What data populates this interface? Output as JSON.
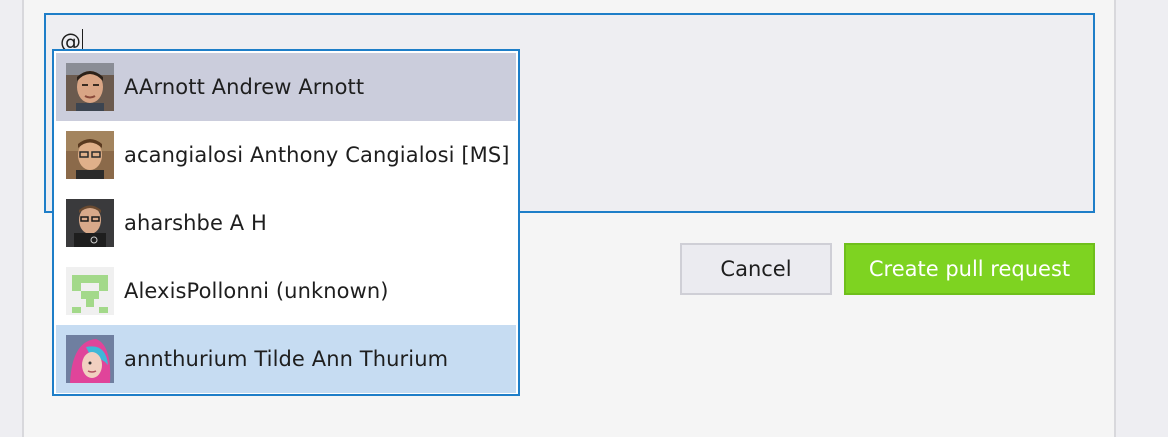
{
  "comment_box": {
    "value": "@"
  },
  "actions": {
    "cancel_label": "Cancel",
    "create_label": "Create pull request"
  },
  "mention_suggestions": {
    "items": [
      {
        "label": "AArnott Andrew Arnott",
        "avatar": "user-avatar-icon",
        "state": "selected"
      },
      {
        "label": "acangialosi Anthony Cangialosi [MS]",
        "avatar": "user-avatar-icon",
        "state": "normal"
      },
      {
        "label": "aharshbe A H",
        "avatar": "user-avatar-icon",
        "state": "normal"
      },
      {
        "label": "AlexisPollonni (unknown)",
        "avatar": "identicon-icon",
        "state": "normal"
      },
      {
        "label": "annthurium Tilde Ann Thurium",
        "avatar": "user-avatar-icon",
        "state": "hover"
      }
    ]
  },
  "colors": {
    "accent_border": "#1e7ec8",
    "create_button": "#7ed321",
    "selected_row": "#cbcddc",
    "hover_row": "#c6dcf2"
  }
}
